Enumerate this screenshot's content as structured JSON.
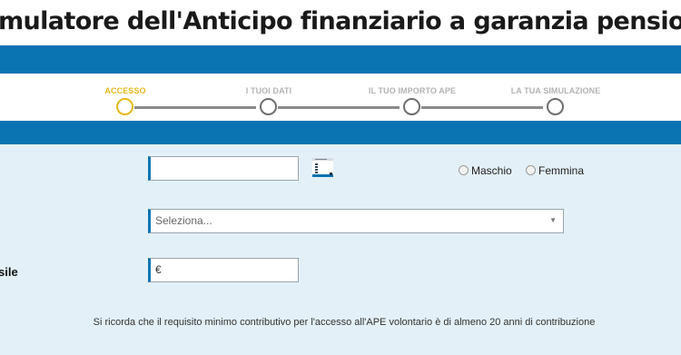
{
  "page_title": "mulatore dell'Anticipo finanziario a garanzia pensionistica (AP",
  "stepper": {
    "steps": [
      {
        "label": "ACCESSO",
        "active": true
      },
      {
        "label": "I TUOI DATI",
        "active": false
      },
      {
        "label": "IL TUO IMPORTO APE",
        "active": false
      },
      {
        "label": "LA TUA SIMULAZIONE",
        "active": false
      }
    ]
  },
  "form": {
    "birthdate": {
      "value": "",
      "calendar_icon": "calendar-icon"
    },
    "gender": {
      "options": [
        "Maschio",
        "Femmina"
      ],
      "selected": null
    },
    "select": {
      "placeholder": "Seleziona...",
      "arrow_icon": "dropdown-arrow-icon"
    },
    "amount": {
      "prefix": "€"
    },
    "amount_label_fragment": "sile"
  },
  "note": "Si ricorda che il requisito minimo contributivo per l'accesso all'APE volontario è di almeno 20 anni di contribuzione",
  "colors": {
    "brand_blue": "#0a73b2",
    "active_step": "#e7b91b",
    "form_bg": "#e3f0f8"
  }
}
